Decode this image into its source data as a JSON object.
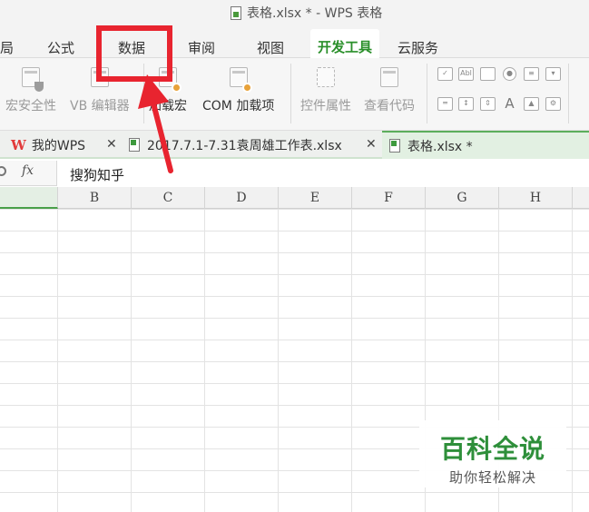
{
  "window": {
    "title": "表格.xlsx * - WPS 表格"
  },
  "menu": {
    "tabs": [
      "局",
      "公式",
      "数据",
      "审阅",
      "视图",
      "开发工具",
      "云服务"
    ],
    "active": "开发工具"
  },
  "ribbon": {
    "buttons": [
      {
        "label": "宏安全性",
        "icon": "macro-security-icon",
        "enabled": false
      },
      {
        "label": "VB 编辑器",
        "icon": "vb-editor-icon",
        "enabled": false
      },
      {
        "label": "加载宏",
        "icon": "load-macro-icon",
        "enabled": true
      },
      {
        "label": "COM 加载项",
        "icon": "com-addin-icon",
        "enabled": true
      },
      {
        "label": "控件属性",
        "icon": "control-properties-icon",
        "enabled": false
      },
      {
        "label": "查看代码",
        "icon": "view-code-icon",
        "enabled": false
      }
    ],
    "small_controls": {
      "label_abl": "Abl",
      "letter_a": "A"
    }
  },
  "document_tabs": [
    {
      "label": "我的WPS",
      "logo": "W"
    },
    {
      "label": "2017.7.1-7.31袁周雄工作表.xlsx"
    },
    {
      "label": "表格.xlsx *"
    }
  ],
  "formula_bar": {
    "fx": "fx",
    "value": "搜狗知乎"
  },
  "columns": [
    "B",
    "C",
    "D",
    "E",
    "F",
    "G",
    "H"
  ],
  "watermark": {
    "title": "百科全说",
    "subtitle": "助你轻松解决"
  },
  "colors": {
    "active_green": "#2a8f2a",
    "annotation_red": "#e8242f",
    "watermark_green": "#2e8f3a"
  }
}
